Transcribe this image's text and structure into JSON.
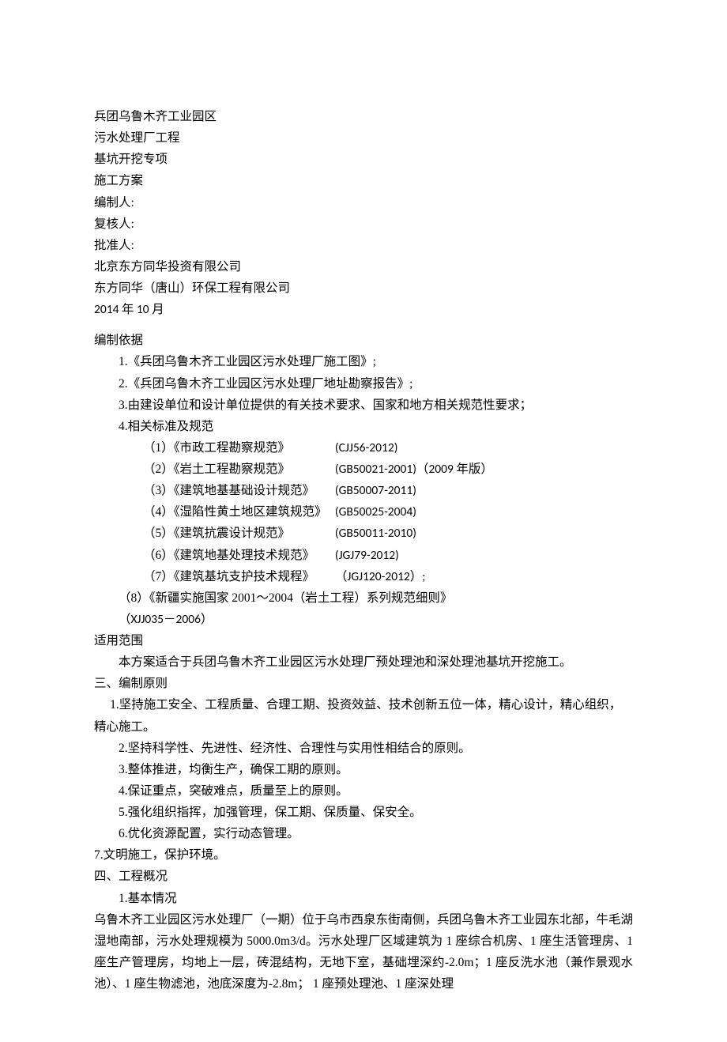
{
  "header": {
    "line1": "兵团乌鲁木齐工业园区",
    "line2": "污水处理厂工程",
    "line3": "基坑开挖专项",
    "line4": "施工方案",
    "line5": "编制人:",
    "line6": "复核人:",
    "line7": "批准人:",
    "line8": "北京东方同华投资有限公司",
    "line9": "东方同华（唐山）环保工程有限公司",
    "line10": "2014 年 10 月"
  },
  "s1": {
    "title": "编制依据",
    "i1": "1.《兵团乌鲁木齐工业园区污水处理厂施工图》;",
    "i2": "2.《兵团乌鲁木齐工业园区污水处理厂地址勘察报告》;",
    "i3": "3.由建设单位和设计单位提供的有关技术要求、国家和地方相关规范性要求；",
    "i4": "4.相关标准及规范",
    "std": [
      {
        "label": "（1）《市政工程勘察规范》",
        "code": "(CJJ56-2012)"
      },
      {
        "label": "（2）《岩土工程勘察规范》",
        "code": "(GB50021-2001)（2009 年版）"
      },
      {
        "label": "（3）《建筑地基基础设计规范》",
        "code": "(GB50007-2011)"
      },
      {
        "label": "（4）《湿陷性黄土地区建筑规范》",
        "code": "(GB50025-2004)"
      },
      {
        "label": "（5）《建筑抗震设计规范》",
        "code": "(GB50011-2010)"
      },
      {
        "label": "（6）《建筑地基处理技术规范》",
        "code": "(JGJ79-2012)"
      },
      {
        "label": "（7）《建筑基坑支护技术规程》",
        "code": "（JGJ120-2012）;"
      }
    ],
    "i8": "（8）《新疆实施国家 2001～2004（岩土工程）系列规范细则》",
    "i8code": "（XJJ035－2006）"
  },
  "s2": {
    "title": "适用范围",
    "body": "本方案适合于兵团乌鲁木齐工业园区污水处理厂预处理池和深处理池基坑开挖施工。"
  },
  "s3": {
    "title": "三、编制原则",
    "i1": "1.坚持施工安全、工程质量、合理工期、投资效益、技术创新五位一体，精心设计，精心组织，精心施工。",
    "i2": "2.坚持科学性、先进性、经济性、合理性与实用性相结合的原则。",
    "i3": "3.整体推进，均衡生产，确保工期的原则。",
    "i4": "4.保证重点，突破难点，质量至上的原则。",
    "i5": "5.强化组织指挥，加强管理，保工期、保质量、保安全。",
    "i6": "6.优化资源配置，实行动态管理。",
    "i7": "7.文明施工，保护环境。"
  },
  "s4": {
    "title": "四、工程概况",
    "sub1": "1.基本情况",
    "body": "乌鲁木齐工业园区污水处理厂（一期）位于乌市西泉东街南侧，兵团乌鲁木齐工业园东北部，牛毛湖湿地南部，污水处理规模为 5000.0m3/d。污水处理厂区域建筑为 1 座综合机房、1 座生活管理房、1 座生产管理房，均地上一层，砖混结构，无地下室，基础埋深约-2.0m；1 座反洗水池（兼作景观水池）、1 座生物滤池，池底深度为-2.8m； 1 座预处理池、1 座深处理"
  }
}
